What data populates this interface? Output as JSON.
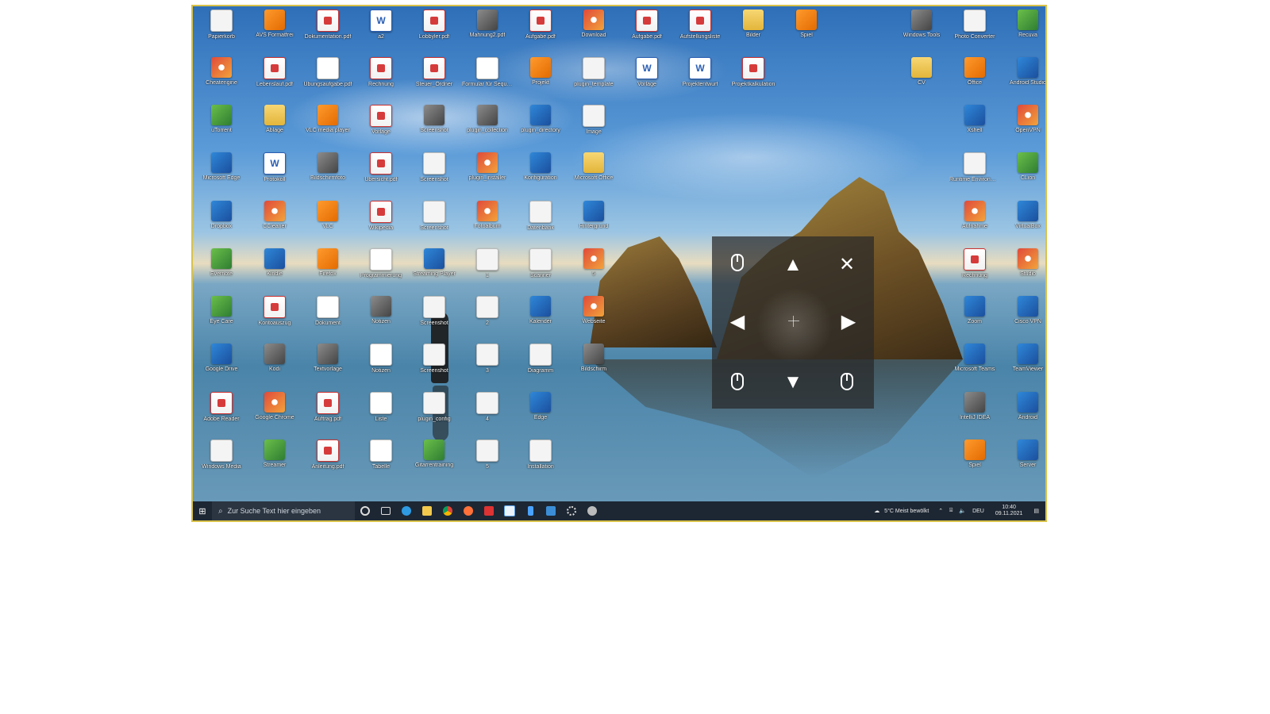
{
  "desktop": {
    "icons": [
      {
        "label": "Papierkorb",
        "type": "g-white"
      },
      {
        "label": "AVS Formatfrei",
        "type": "g-orange"
      },
      {
        "label": "Dokumentation.pdf",
        "type": "g-pdf"
      },
      {
        "label": "a2",
        "type": "g-word"
      },
      {
        "label": "Lobbyler.pdf",
        "type": "g-pdf"
      },
      {
        "label": "Mahnung2.pdf",
        "type": "g-gray"
      },
      {
        "label": "Aufgabe.pdf",
        "type": "g-pdf"
      },
      {
        "label": "Download",
        "type": "g-app"
      },
      {
        "label": "Aufgabe.pdf",
        "type": "g-pdf"
      },
      {
        "label": "Aufstellungsliste",
        "type": "g-pdf"
      },
      {
        "label": "Bilder",
        "type": "g-folder"
      },
      {
        "label": "Spiel",
        "type": "g-orange"
      },
      {
        "label": "Windows Tools",
        "type": "g-gray"
      },
      {
        "label": "Photo Converter",
        "type": "g-white"
      },
      {
        "label": "Recuva",
        "type": "g-green"
      },
      {
        "label": "Cheatengine",
        "type": "g-app"
      },
      {
        "label": "Lebenslauf.pdf",
        "type": "g-pdf"
      },
      {
        "label": "Übungsaufgabe.pdf",
        "type": "g-doc"
      },
      {
        "label": "Rechnung",
        "type": "g-pdf"
      },
      {
        "label": "Steuer_Ordner",
        "type": "g-pdf"
      },
      {
        "label": "Formular für Sequenzer",
        "type": "g-doc"
      },
      {
        "label": "Projekt",
        "type": "g-orange"
      },
      {
        "label": "plugin_template",
        "type": "g-white"
      },
      {
        "label": "Vorlage",
        "type": "g-word"
      },
      {
        "label": "Projektentwurf",
        "type": "g-word"
      },
      {
        "label": "Projektkalkulation",
        "type": "g-pdf"
      },
      {
        "label": "CV",
        "type": "g-folder"
      },
      {
        "label": "Office",
        "type": "g-orange"
      },
      {
        "label": "Android Studio",
        "type": "g-blue"
      },
      {
        "label": "uTorrent",
        "type": "g-green"
      },
      {
        "label": "Ablage",
        "type": "g-folder"
      },
      {
        "label": "VLC media player",
        "type": "g-orange"
      },
      {
        "label": "Vorlage",
        "type": "g-pdf"
      },
      {
        "label": "Screenshot",
        "type": "g-gray"
      },
      {
        "label": "plugin_collection",
        "type": "g-gray"
      },
      {
        "label": "plugin_directory",
        "type": "g-blue"
      },
      {
        "label": "Image",
        "type": "g-white"
      },
      {
        "label": "Xshell",
        "type": "g-blue"
      },
      {
        "label": "OpenVPN",
        "type": "g-app"
      },
      {
        "label": "Microsoft Edge",
        "type": "g-blue"
      },
      {
        "label": "Protokoll",
        "type": "g-word"
      },
      {
        "label": "Bildschirmfoto",
        "type": "g-gray"
      },
      {
        "label": "Übersicht.pdf",
        "type": "g-pdf"
      },
      {
        "label": "Screenshot",
        "type": "g-white"
      },
      {
        "label": "plugin_installer",
        "type": "g-app"
      },
      {
        "label": "Konfiguration",
        "type": "g-blue"
      },
      {
        "label": "Microsoft Office",
        "type": "g-folder"
      },
      {
        "label": "Runtime Environment",
        "type": "g-white"
      },
      {
        "label": "CLion",
        "type": "g-green"
      },
      {
        "label": "Dropbox",
        "type": "g-blue"
      },
      {
        "label": "CCleaner",
        "type": "g-app"
      },
      {
        "label": "VLC",
        "type": "g-orange"
      },
      {
        "label": "Wikipedia",
        "type": "g-pdf"
      },
      {
        "label": "Screenshot",
        "type": "g-white"
      },
      {
        "label": "Fotoalbum",
        "type": "g-app"
      },
      {
        "label": "Datenbank",
        "type": "g-white"
      },
      {
        "label": "Hintergrund",
        "type": "g-blue"
      },
      {
        "label": "Aufnahme",
        "type": "g-app"
      },
      {
        "label": "VirtualBox",
        "type": "g-blue"
      },
      {
        "label": "Evernote",
        "type": "g-green"
      },
      {
        "label": "Kindle",
        "type": "g-blue"
      },
      {
        "label": "Firefox",
        "type": "g-orange"
      },
      {
        "label": "Programmierung",
        "type": "g-doc"
      },
      {
        "label": "Streaming Player",
        "type": "g-blue"
      },
      {
        "label": "1",
        "type": "g-white"
      },
      {
        "label": "Scanner",
        "type": "g-white"
      },
      {
        "label": "5",
        "type": "g-app"
      },
      {
        "label": "Rechnung",
        "type": "g-pdf"
      },
      {
        "label": "Studio",
        "type": "g-app"
      },
      {
        "label": "Eye Care",
        "type": "g-green"
      },
      {
        "label": "Kontoauszug",
        "type": "g-pdf"
      },
      {
        "label": "Dokument",
        "type": "g-doc"
      },
      {
        "label": "Notizen",
        "type": "g-gray"
      },
      {
        "label": "Screenshot",
        "type": "g-white"
      },
      {
        "label": "2",
        "type": "g-white"
      },
      {
        "label": "Kalender",
        "type": "g-blue"
      },
      {
        "label": "Webseite",
        "type": "g-app"
      },
      {
        "label": "Zoom",
        "type": "g-blue"
      },
      {
        "label": "Cisco VPN",
        "type": "g-blue"
      },
      {
        "label": "Google Drive",
        "type": "g-blue"
      },
      {
        "label": "Kodi",
        "type": "g-gray"
      },
      {
        "label": "Textvorlage",
        "type": "g-gray"
      },
      {
        "label": "Notizen",
        "type": "g-doc"
      },
      {
        "label": "Screenshot",
        "type": "g-white"
      },
      {
        "label": "3",
        "type": "g-white"
      },
      {
        "label": "Diagramm",
        "type": "g-white"
      },
      {
        "label": "Bildschirm",
        "type": "g-gray"
      },
      {
        "label": "Microsoft Teams",
        "type": "g-blue"
      },
      {
        "label": "TeamViewer",
        "type": "g-blue"
      },
      {
        "label": "Adobe Reader",
        "type": "g-pdf"
      },
      {
        "label": "Google Chrome",
        "type": "g-app"
      },
      {
        "label": "Auftrag.pdf",
        "type": "g-pdf"
      },
      {
        "label": "Liste",
        "type": "g-doc"
      },
      {
        "label": "plugin_config",
        "type": "g-white"
      },
      {
        "label": "4",
        "type": "g-white"
      },
      {
        "label": "Edge",
        "type": "g-blue"
      },
      {
        "label": "IntelliJ IDEA",
        "type": "g-gray"
      },
      {
        "label": "Android",
        "type": "g-blue"
      },
      {
        "label": "Windows Media",
        "type": "g-white"
      },
      {
        "label": "Streamer",
        "type": "g-green"
      },
      {
        "label": "Anleitung.pdf",
        "type": "g-pdf"
      },
      {
        "label": "Tabelle",
        "type": "g-doc"
      },
      {
        "label": "Gitarrentraining",
        "type": "g-green"
      },
      {
        "label": "5",
        "type": "g-white"
      },
      {
        "label": "Installation",
        "type": "g-white"
      },
      {
        "label": "Spiel",
        "type": "g-orange"
      },
      {
        "label": "Server",
        "type": "g-blue"
      }
    ]
  },
  "overlay": {
    "left_click_icon": "mouse-left-icon",
    "up_arrow": "▲",
    "close": "✕",
    "left_arrow": "◀",
    "right_arrow": "▶",
    "down_arrow": "▼",
    "double_click_icon": "mouse-double-icon",
    "right_click_icon": "mouse-right-icon"
  },
  "taskbar": {
    "start_glyph": "⊞",
    "search_placeholder": "Zur Suche Text hier eingeben",
    "weather": "5°C Meist bewölkt",
    "lang": "DEU",
    "time": "10:40",
    "date": "09.11.2021"
  }
}
